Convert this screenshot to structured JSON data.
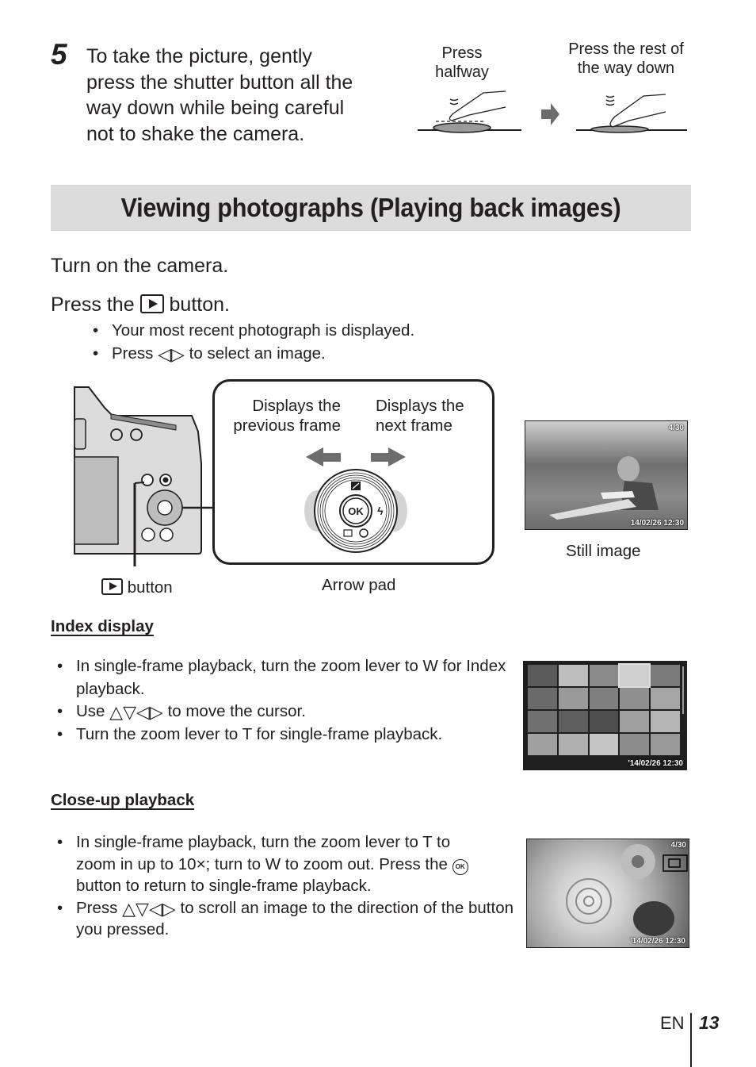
{
  "step5": {
    "number": "5",
    "lines": [
      "To take the picture, gently",
      "press the shutter button all the",
      "way down while being careful",
      "not to shake the camera."
    ],
    "figure": {
      "label_halfway": [
        "Press",
        "halfway"
      ],
      "label_full": [
        "Press the rest of",
        "the way down"
      ]
    }
  },
  "banner": {
    "title": "Viewing photographs (Playing back images)",
    "background": "#dcdcdc"
  },
  "instructions": {
    "turn_on": "Turn on the camera.",
    "press_prefix": "Press the",
    "press_suffix": "button.",
    "bullets": [
      "Your most recent photograph is displayed.",
      {
        "prefix": "Press",
        "symbols": "◁▷",
        "suffix": "to select an image."
      }
    ]
  },
  "diagram": {
    "prev_label": [
      "Displays the",
      "previous frame"
    ],
    "next_label": [
      "Displays the",
      "next frame"
    ],
    "ok_label": "OK",
    "play_button_caption": "button",
    "arrow_pad_caption": "Arrow pad",
    "still_image_caption": "Still image",
    "still_image_osd": {
      "frame_counter": "4/30",
      "timestamp": "14/02/26  12:30"
    }
  },
  "index_display": {
    "heading": "Index display",
    "bullets": [
      "In single-frame playback, turn the zoom lever to W for Index playback.",
      {
        "prefix": "Use",
        "symbols": "△▽◁▷",
        "suffix": "to move the cursor."
      },
      "Turn the zoom lever to T for single-frame playback."
    ],
    "osd_timestamp": "'14/02/26  12:30",
    "grid": {
      "columns": 5,
      "rows": 4
    }
  },
  "closeup": {
    "heading": "Close-up playback",
    "bullet1": {
      "line1": "In single-frame playback, turn the zoom lever to T to",
      "line2_prefix": "zoom in up to 10×; turn to W to zoom out. Press the",
      "ok_icon": "OK",
      "line3": "button to return to single-frame playback."
    },
    "bullet2": {
      "prefix": "Press",
      "symbols": "△▽◁▷",
      "suffix": "to scroll an image to the direction of the button you pressed."
    },
    "osd_counter": "4/30",
    "osd_timestamp": "'14/02/26  12:30"
  },
  "footer": {
    "language": "EN",
    "page_number": "13"
  }
}
